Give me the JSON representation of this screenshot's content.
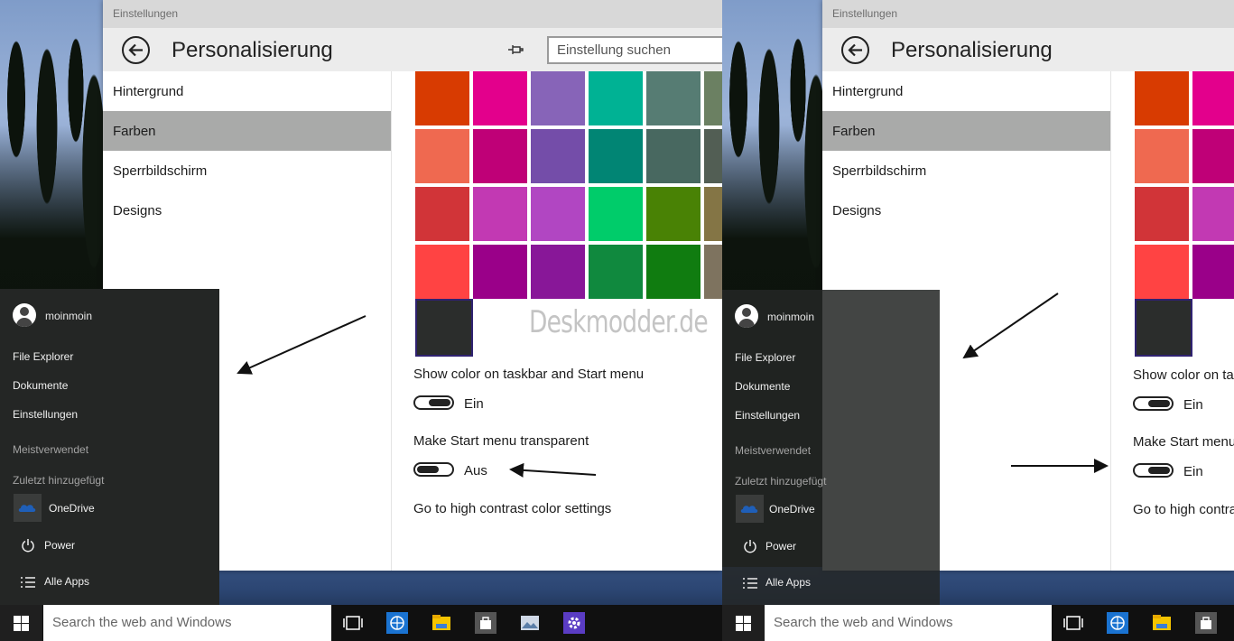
{
  "colors": {
    "row1": [
      "#d83b01",
      "#e3008c",
      "#8764b8",
      "#00b294",
      "#567c73",
      "#6b8062"
    ],
    "row2": [
      "#ef6950",
      "#bf0077",
      "#744da9",
      "#018574",
      "#486860",
      "#525e54"
    ],
    "row3": [
      "#d13438",
      "#c239b3",
      "#b146c2",
      "#00cc6a",
      "#498205",
      "#847545"
    ],
    "row4": [
      "#ff4343",
      "#9a0089",
      "#881798",
      "#10893e",
      "#107c10",
      "#7e735f"
    ],
    "selected": "#2b2d2c"
  },
  "left": {
    "window_title": "Einstellungen",
    "page_title": "Personalisierung",
    "search_placeholder": "Einstellung suchen",
    "nav": [
      "Hintergrund",
      "Farben",
      "Sperrbildschirm",
      "Designs"
    ],
    "watermark": "Deskmodder.de",
    "option1_label": "Show color on taskbar and Start menu",
    "option1_state": "Ein",
    "option2_label": "Make Start menu transparent",
    "option2_state": "Aus",
    "link": "Go to high contrast color settings",
    "start": {
      "user": "moinmoin",
      "places": [
        "File Explorer",
        "Dokumente",
        "Einstellungen"
      ],
      "most_used": "Meistverwendet",
      "recently_added": "Zuletzt hinzugefügt",
      "app": "OneDrive",
      "power": "Power",
      "all_apps": "Alle Apps"
    },
    "taskbar_search": "Search the web and Windows"
  },
  "right": {
    "window_title": "Einstellungen",
    "page_title": "Personalisierung",
    "nav": [
      "Hintergrund",
      "Farben",
      "Sperrbildschirm",
      "Designs"
    ],
    "option1_label": "Show color on ta",
    "option1_state": "Ein",
    "option2_label": "Make Start menu",
    "option2_state": "Ein",
    "link": "Go to high contrast",
    "start": {
      "user": "moinmoin",
      "places": [
        "File Explorer",
        "Dokumente",
        "Einstellungen"
      ],
      "most_used": "Meistverwendet",
      "recently_added": "Zuletzt hinzugefügt",
      "app": "OneDrive",
      "power": "Power",
      "all_apps": "Alle Apps"
    },
    "taskbar_search": "Search the web and Windows"
  }
}
